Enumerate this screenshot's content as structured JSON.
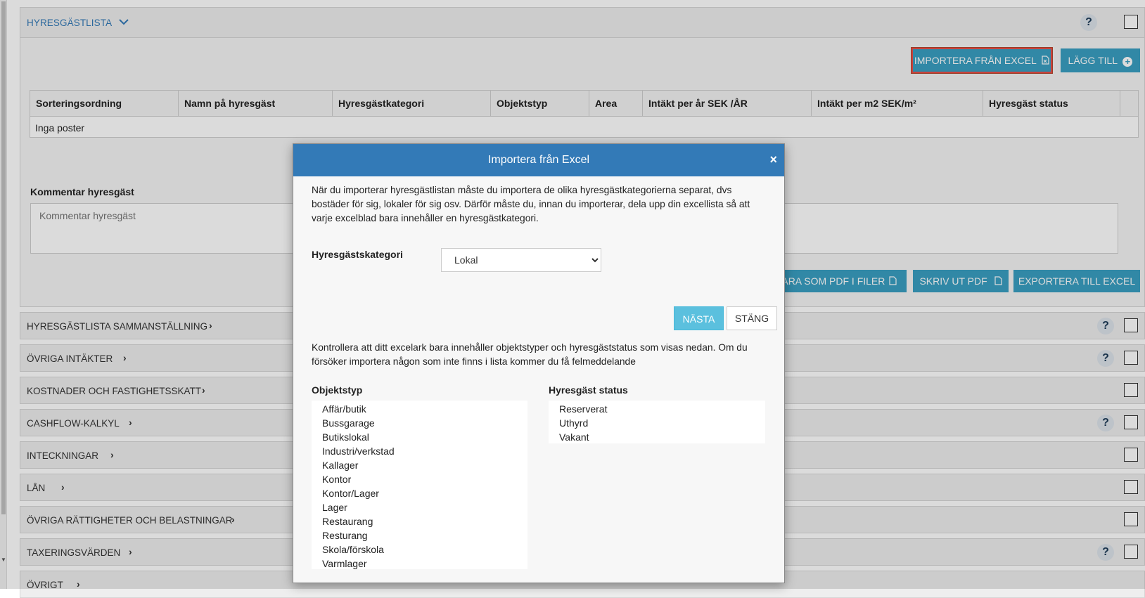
{
  "panel": {
    "title": "HYRESGÄSTLISTA",
    "chevron": "chevron-down-icon",
    "import_button": "IMPORTERA FRÅN EXCEL",
    "add_button": "LÄGG TILL",
    "help": "?"
  },
  "table": {
    "columns": [
      "Sorteringsordning",
      "Namn på hyresgäst",
      "Hyresgästkategori",
      "Objektstyp",
      "Area",
      "Intäkt per år SEK /ÅR",
      "Intäkt per m2 SEK/m²",
      "Hyresgäst status"
    ],
    "empty_text": "Inga poster"
  },
  "comment": {
    "label": "Kommentar hyresgäst",
    "placeholder": "Kommentar hyresgäst"
  },
  "actions": {
    "save_pdf": "SPARA SOM PDF I FILER",
    "print_pdf": "SKRIV UT PDF",
    "export_excel": "EXPORTERA TILL EXCEL"
  },
  "sections": [
    {
      "label": "HYRESGÄSTLISTA SAMMANSTÄLLNING",
      "help": true
    },
    {
      "label": "ÖVRIGA INTÄKTER",
      "help": true
    },
    {
      "label": "KOSTNADER OCH FASTIGHETSSKATT",
      "help": false
    },
    {
      "label": "CASHFLOW-KALKYL",
      "help": true
    },
    {
      "label": "INTECKNINGAR",
      "help": false
    },
    {
      "label": "LÅN",
      "help": false
    },
    {
      "label": "ÖVRIGA RÄTTIGHETER OCH BELASTNINGAR",
      "help": false
    },
    {
      "label": "TAXERINGSVÄRDEN",
      "help": true
    },
    {
      "label": "ÖVRIGT",
      "help": false
    }
  ],
  "modal": {
    "title": "Importera från Excel",
    "close": "×",
    "intro": "När du importerar hyresgästlistan måste du importera de olika hyresgästkategorierna separat, dvs bostäder för sig, lokaler för sig osv. Därför måste du, innan du importerar, dela upp din excellista så att varje excelblad bara innehåller en hyresgästkategori.",
    "category_label": "Hyresgästskategori",
    "category_value": "Lokal",
    "next_button": "NÄSTA",
    "close_button": "STÄNG",
    "check_text": "Kontrollera att ditt excelark bara innehåller objektstyper och hyresgäststatus som visas nedan. Om du försöker importera någon som inte finns i lista kommer du få felmeddelande",
    "object_types_label": "Objektstyp",
    "object_types": [
      "Affär/butik",
      "Bussgarage",
      "Butikslokal",
      "Industri/verkstad",
      "Kallager",
      "Kontor",
      "Kontor/Lager",
      "Lager",
      "Restaurang",
      "Resturang",
      "Skola/förskola",
      "Varmlager"
    ],
    "status_label": "Hyresgäst status",
    "statuses": [
      "Reserverat",
      "Uthyrd",
      "Vakant"
    ]
  },
  "colors": {
    "accent": "#3a9fc2",
    "modal_header": "#337ab7",
    "highlight": "#e84d47"
  }
}
